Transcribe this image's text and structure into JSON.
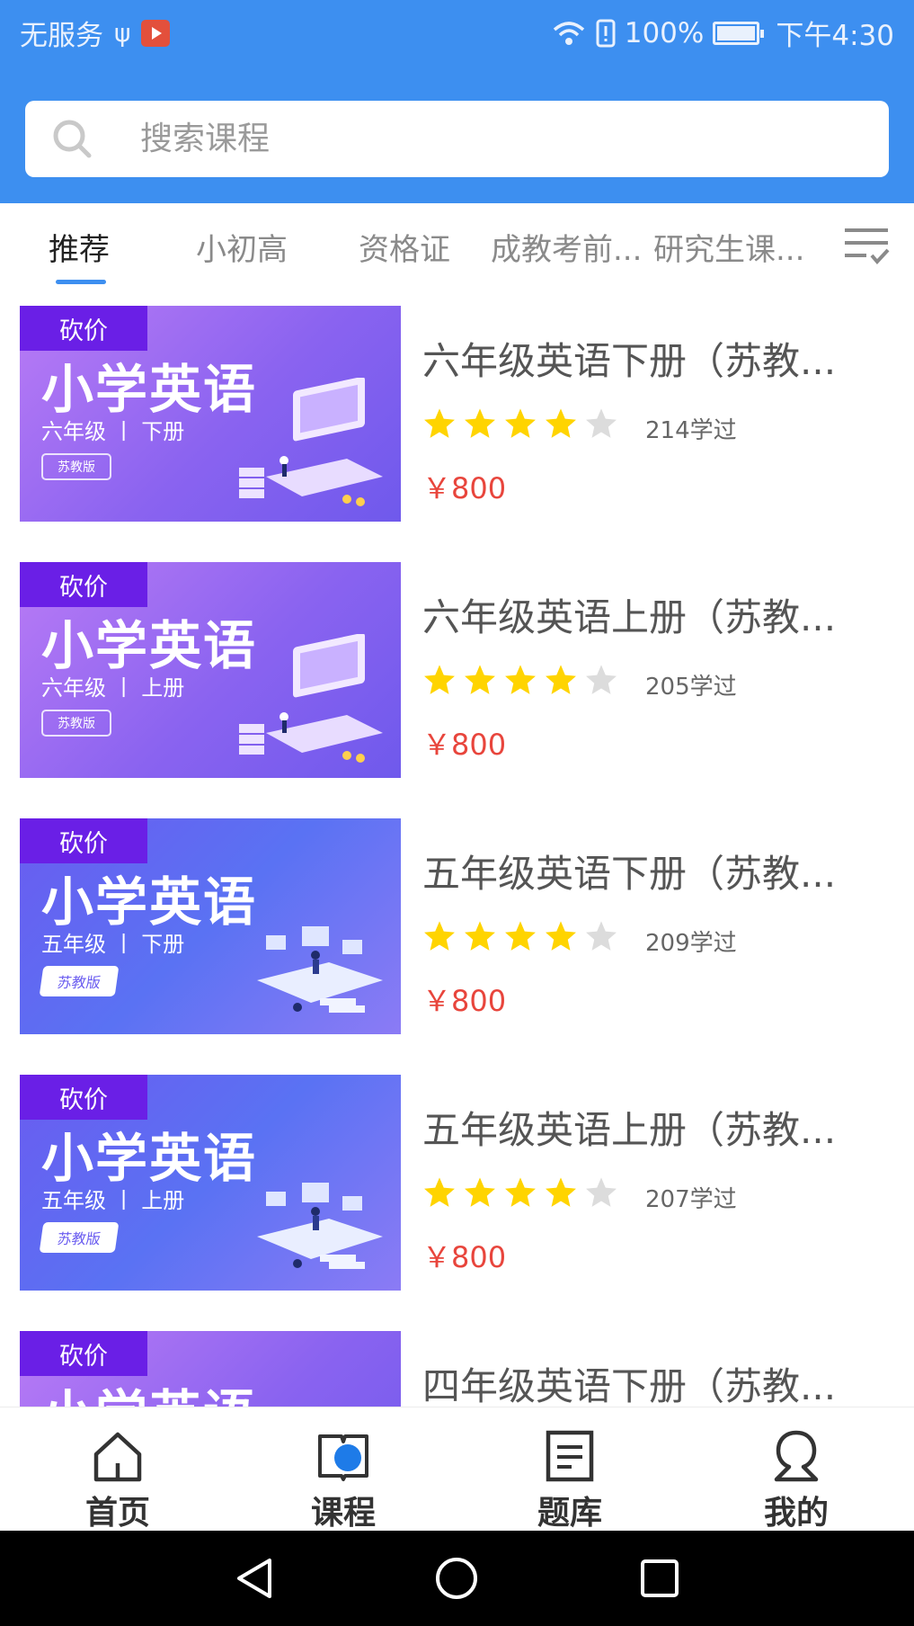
{
  "status_bar": {
    "carrier": "无服务",
    "battery": "100%",
    "time": "下午4:30"
  },
  "search": {
    "placeholder": "搜索课程"
  },
  "tabs": [
    {
      "label": "推荐",
      "active": true
    },
    {
      "label": "小初高",
      "active": false
    },
    {
      "label": "资格证",
      "active": false
    },
    {
      "label": "成教考前...",
      "active": false
    },
    {
      "label": "研究生课...",
      "active": false
    }
  ],
  "courses": [
    {
      "badge": "砍价",
      "thumb_title": "小学英语",
      "thumb_subtitle": "六年级 丨 下册",
      "thumb_edition": "苏教版",
      "title": "六年级英语下册（苏教...",
      "rating": 4,
      "learned": "214学过",
      "price": "￥800"
    },
    {
      "badge": "砍价",
      "thumb_title": "小学英语",
      "thumb_subtitle": "六年级 丨 上册",
      "thumb_edition": "苏教版",
      "title": "六年级英语上册（苏教...",
      "rating": 4,
      "learned": "205学过",
      "price": "￥800"
    },
    {
      "badge": "砍价",
      "thumb_title": "小学英语",
      "thumb_subtitle": "五年级 丨 下册",
      "thumb_edition": "苏教版",
      "title": "五年级英语下册（苏教...",
      "rating": 4,
      "learned": "209学过",
      "price": "￥800"
    },
    {
      "badge": "砍价",
      "thumb_title": "小学英语",
      "thumb_subtitle": "五年级 丨 上册",
      "thumb_edition": "苏教版",
      "title": "五年级英语上册（苏教...",
      "rating": 4,
      "learned": "207学过",
      "price": "￥800"
    },
    {
      "badge": "砍价",
      "thumb_title": "小学英语",
      "title": "四年级英语下册（苏教..."
    }
  ],
  "bottom_nav": [
    {
      "label": "首页",
      "icon": "home-icon"
    },
    {
      "label": "课程",
      "icon": "course-book-icon",
      "active": true
    },
    {
      "label": "题库",
      "icon": "question-bank-icon"
    },
    {
      "label": "我的",
      "icon": "profile-icon"
    }
  ],
  "colors": {
    "primary": "#3d8ff0",
    "price": "#e8453c",
    "star_filled": "#ffd400",
    "star_empty": "#dcdcdc",
    "badge": "#6a1fe6"
  }
}
